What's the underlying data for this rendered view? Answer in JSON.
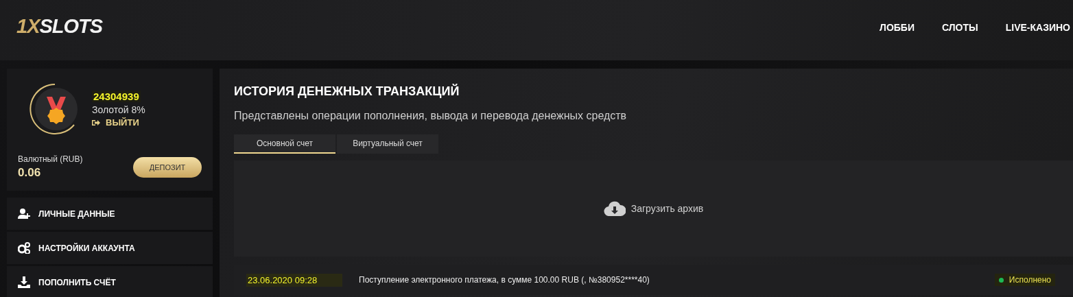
{
  "header": {
    "logo": {
      "accent": "1X",
      "text": "SLOTS"
    },
    "nav": [
      {
        "label": "ЛОББИ"
      },
      {
        "label": "СЛОТЫ"
      },
      {
        "label": "LIVE-КАЗИНО"
      }
    ]
  },
  "profile": {
    "user_id": "24304939",
    "level": "Золотой 8%",
    "logout": "ВЫЙТИ",
    "balance_label": "Валютный (RUB)",
    "balance": "0.06",
    "deposit_button": "ДЕПОЗИТ"
  },
  "sidebar": {
    "items": [
      {
        "label": "ЛИЧНЫЕ ДАННЫЕ"
      },
      {
        "label": "НАСТРОЙКИ АККАУНТА"
      },
      {
        "label": "ПОПОЛНИТЬ СЧЁТ"
      }
    ]
  },
  "main": {
    "title": "ИСТОРИЯ ДЕНЕЖНЫХ ТРАНЗАКЦИЙ",
    "subtitle": "Представлены операции пополнения, вывода и перевода денежных средств",
    "tabs": [
      {
        "label": "Основной счет",
        "selected": true
      },
      {
        "label": "Виртуальный счет",
        "selected": false
      }
    ],
    "archive_button": "Загрузить архив",
    "transactions": [
      {
        "date": "23.06.2020 09:28",
        "description": "Поступление электронного платежа, в сумме 100.00 RUB (, №380952****40)",
        "status": "Исполнено",
        "color": "#1db954"
      }
    ]
  }
}
